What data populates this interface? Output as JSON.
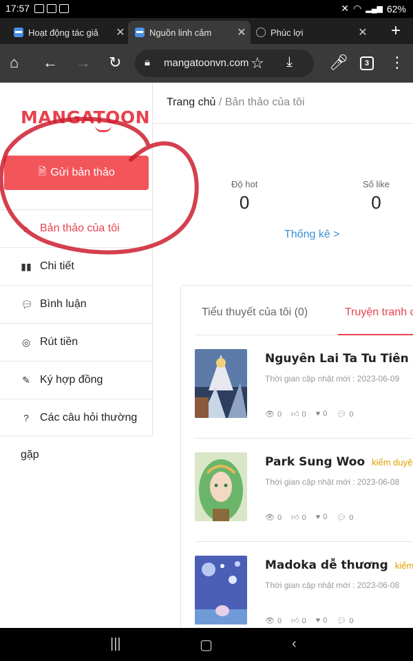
{
  "status_bar": {
    "time": "17:57",
    "battery": "62%",
    "icons": [
      "gallery-icon",
      "app-icon",
      "app-icon",
      "mute-icon",
      "wifi-icon",
      "lte-signal-icon",
      "signal-icon"
    ]
  },
  "browser": {
    "tabs": [
      {
        "label": "Hoạt động tác giả",
        "active": false
      },
      {
        "label": "Nguồn linh cảm",
        "active": true
      },
      {
        "label": "Phúc lợi",
        "active": false
      }
    ],
    "url": "mangatoonvn.com",
    "tab_count": "3"
  },
  "sidebar": {
    "logo": "MANGATOON",
    "submit_label": "Gửi bản thảo",
    "items": [
      {
        "label": "Bản thảo của tôi",
        "icon": "home-icon",
        "active": true
      },
      {
        "label": "Chi tiết",
        "icon": "bar-chart-icon",
        "active": false
      },
      {
        "label": "Bình luận",
        "icon": "comment-icon",
        "active": false
      },
      {
        "label": "Rút tiền",
        "icon": "coin-icon",
        "active": false
      },
      {
        "label": "Ký hợp đồng",
        "icon": "edit-icon",
        "active": false
      },
      {
        "label": "Các câu hỏi thường",
        "icon": "question-icon",
        "active": false
      }
    ],
    "overflow_text": "gặp"
  },
  "breadcrumb": {
    "home": "Trang chủ",
    "separator": "/",
    "current": "Bản thảo của tôi"
  },
  "stats": {
    "hot_label": "Độ hot",
    "hot_value": "0",
    "like_label": "Số like",
    "like_value": "0",
    "link": "Thống kê >"
  },
  "works_tabs": [
    {
      "label": "Tiểu thuyết của tôi (0)",
      "active": false
    },
    {
      "label": "Truyện tranh c",
      "active": true
    }
  ],
  "works": [
    {
      "title": "Nguyên Lai Ta Tu Tiên Đại",
      "badge": "",
      "updated": "Thời gian cập nhật mới : 2023-06-09",
      "views": "0",
      "likes": "0",
      "hearts": "0",
      "comments": "0"
    },
    {
      "title": "Park Sung Woo",
      "badge": "kiểm duyệt",
      "updated": "Thời gian cập nhật mới : 2023-06-08",
      "views": "0",
      "likes": "0",
      "hearts": "0",
      "comments": "0"
    },
    {
      "title": "Madoka dễ thương",
      "badge": "kiểm du",
      "updated": "Thời gian cập nhật mới : 2023-06-08",
      "views": "0",
      "likes": "0",
      "hearts": "0",
      "comments": "0"
    }
  ],
  "colors": {
    "accent": "#e8424f",
    "button": "#f2555a",
    "link": "#3a8fd6",
    "badge": "#e0a100",
    "annotation": "#cc1f2f"
  }
}
